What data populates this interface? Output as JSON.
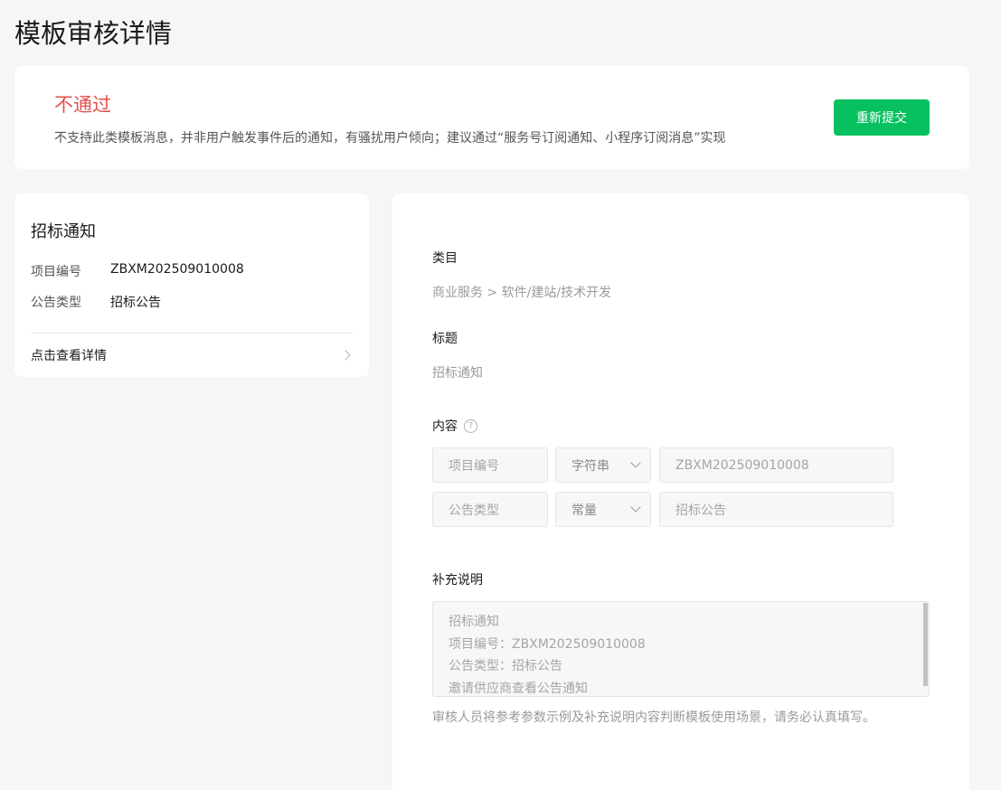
{
  "page": {
    "title": "模板审核详情"
  },
  "status": {
    "title": "不通过",
    "reason": "不支持此类模板消息，并非用户触发事件后的通知，有骚扰用户倾向；建议通过“服务号订阅通知、小程序订阅消息”实现",
    "resubmit_label": "重新提交"
  },
  "preview": {
    "title": "招标通知",
    "rows": [
      {
        "key": "项目编号",
        "value": "ZBXM202509010008"
      },
      {
        "key": "公告类型",
        "value": "招标公告"
      }
    ],
    "detail_link": "点击查看详情"
  },
  "detail": {
    "category_label": "类目",
    "category_value": "商业服务 > 软件/建站/技术开发",
    "title_label": "标题",
    "title_value": "招标通知",
    "content_label": "内容",
    "help_icon": "?",
    "fields": [
      {
        "name": "项目编号",
        "type": "字符串",
        "example": "ZBXM202509010008"
      },
      {
        "name": "公告类型",
        "type": "常量",
        "example": "招标公告"
      }
    ],
    "note_label": "补充说明",
    "note_lines": [
      "招标通知",
      "项目编号：ZBXM202509010008",
      "公告类型：招标公告",
      "邀请供应商查看公告通知"
    ],
    "note_tip": "审核人员将参考参数示例及补充说明内容判断模板使用场景，请务必认真填写。"
  },
  "colors": {
    "accent": "#07c160",
    "reject": "#e4514d"
  }
}
